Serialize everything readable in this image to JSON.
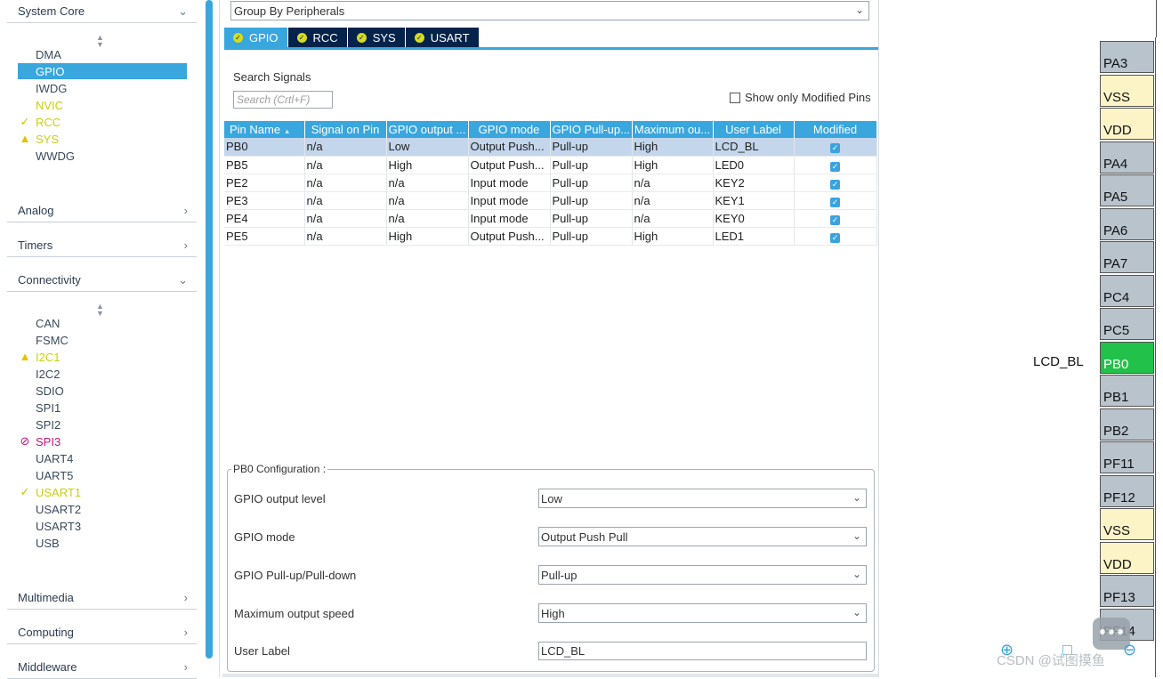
{
  "sidebar": {
    "categories": {
      "system_core": "System Core",
      "analog": "Analog",
      "timers": "Timers",
      "connectivity": "Connectivity",
      "multimedia": "Multimedia",
      "computing": "Computing",
      "middleware": "Middleware"
    },
    "system_core_items": [
      "DMA",
      "GPIO",
      "IWDG",
      "NVIC",
      "RCC",
      "SYS",
      "WWDG"
    ],
    "connectivity_items": [
      "CAN",
      "FSMC",
      "I2C1",
      "I2C2",
      "SDIO",
      "SPI1",
      "SPI2",
      "SPI3",
      "UART4",
      "UART5",
      "USART1",
      "USART2",
      "USART3",
      "USB"
    ]
  },
  "main": {
    "group_by": "Group By Peripherals",
    "tabs": [
      "GPIO",
      "RCC",
      "SYS",
      "USART"
    ],
    "search_label": "Search Signals",
    "search_placeholder": "Search (Crtl+F)",
    "show_modified_label": "Show only Modified Pins",
    "table": {
      "headers": [
        "Pin Name",
        "Signal on Pin",
        "GPIO output ...",
        "GPIO mode",
        "GPIO Pull-up...",
        "Maximum ou...",
        "User Label",
        "Modified"
      ],
      "rows": [
        [
          "PB0",
          "n/a",
          "Low",
          "Output Push...",
          "Pull-up",
          "High",
          "LCD_BL"
        ],
        [
          "PB5",
          "n/a",
          "High",
          "Output Push...",
          "Pull-up",
          "High",
          "LED0"
        ],
        [
          "PE2",
          "n/a",
          "n/a",
          "Input mode",
          "Pull-up",
          "n/a",
          "KEY2"
        ],
        [
          "PE3",
          "n/a",
          "n/a",
          "Input mode",
          "Pull-up",
          "n/a",
          "KEY1"
        ],
        [
          "PE4",
          "n/a",
          "n/a",
          "Input mode",
          "Pull-up",
          "n/a",
          "KEY0"
        ],
        [
          "PE5",
          "n/a",
          "High",
          "Output Push...",
          "Pull-up",
          "High",
          "LED1"
        ]
      ]
    },
    "config": {
      "title": "PB0 Configuration :",
      "output_level_label": "GPIO output level",
      "output_level_value": "Low",
      "mode_label": "GPIO mode",
      "mode_value": "Output Push Pull",
      "pull_label": "GPIO Pull-up/Pull-down",
      "pull_value": "Pull-up",
      "speed_label": "Maximum output speed",
      "speed_value": "High",
      "user_label_label": "User Label",
      "user_label_value": "LCD_BL"
    }
  },
  "pinout": {
    "pins": [
      "PA3",
      "VSS",
      "VDD",
      "PA4",
      "PA5",
      "PA6",
      "PA7",
      "PC4",
      "PC5",
      "PB0",
      "PB1",
      "PB2",
      "PF11",
      "PF12",
      "VSS",
      "VDD",
      "PF13",
      "PF14"
    ],
    "pb0_label": "LCD_BL",
    "watermark": "CSDN @试图摸鱼"
  },
  "colors": {
    "accent": "#39a6dd",
    "tab_dark": "#03234b",
    "pin_default": "#b9c3cc",
    "pin_power": "#fcf3c7",
    "pin_active": "#22c14a",
    "ok_yellow": "#c9cf10",
    "error_magenta": "#c8147b"
  }
}
